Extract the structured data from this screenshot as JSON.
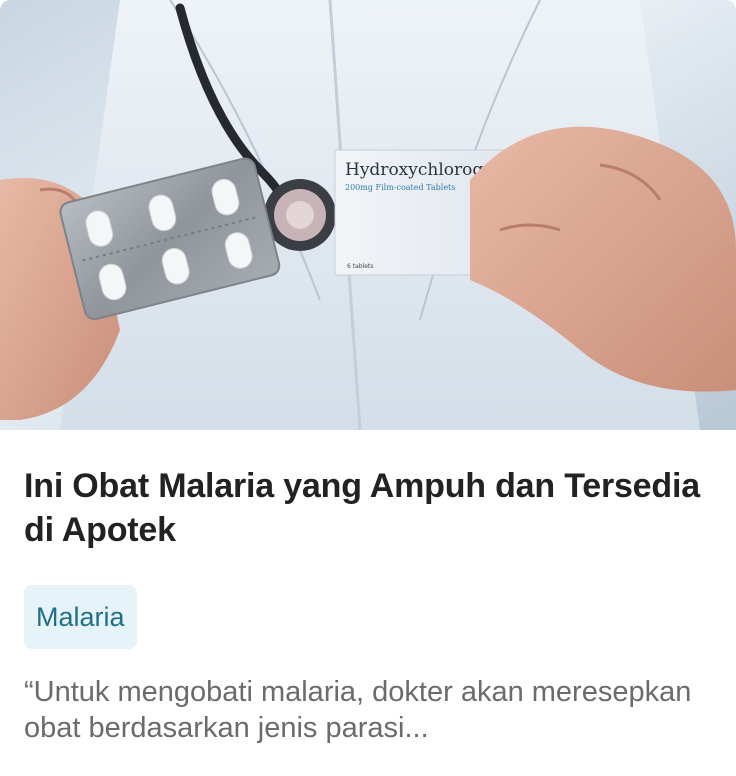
{
  "article": {
    "image_alt": "Doctor holding Hydroxychloroquine box and tablet blister",
    "box_brand": "Hydroxychloroquine",
    "box_sub": "200mg Film-coated Tablets",
    "box_count": "6 tablets",
    "title": "Ini Obat Malaria yang Ampuh dan Tersedia di Apotek",
    "tag": "Malaria",
    "excerpt": "“Untuk mengobati malaria, dokter akan meresepkan obat berdasarkan jenis parasi..."
  }
}
